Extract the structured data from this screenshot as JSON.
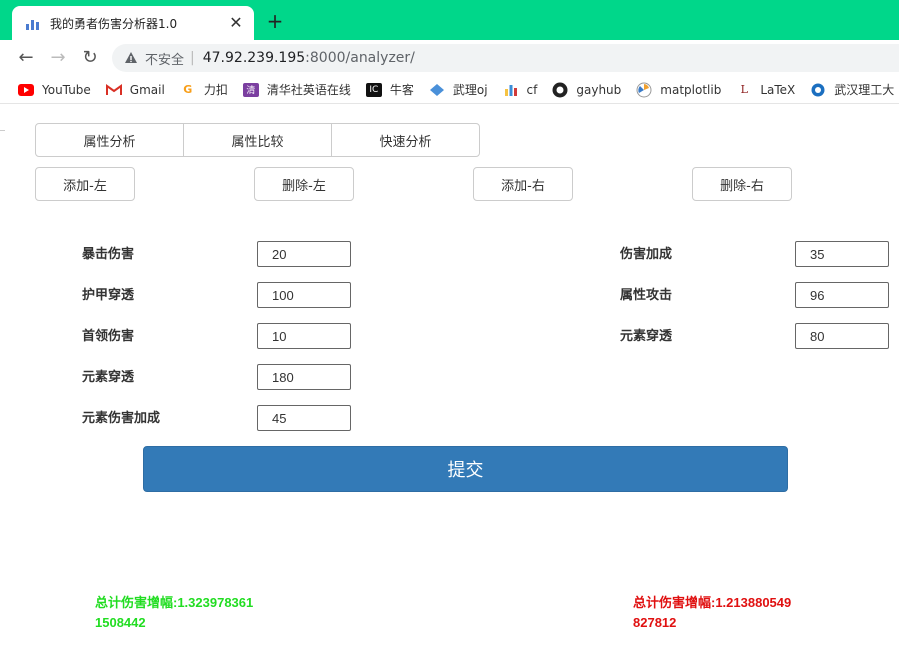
{
  "browser": {
    "tab_title": "我的勇者伤害分析器1.0",
    "insecure_label": "不安全",
    "url_host": "47.92.239.195",
    "url_path": ":8000/analyzer/",
    "bookmarks": [
      "YouTube",
      "Gmail",
      "力扣",
      "清华社英语在线",
      "牛客",
      "武理oj",
      "cf",
      "gayhub",
      "matplotlib",
      "LaTeX",
      "武汉理工大"
    ]
  },
  "tabs": [
    "属性分析",
    "属性比较",
    "快速分析"
  ],
  "actions": {
    "add_left": "添加-左",
    "delete_left": "删除-左",
    "add_right": "添加-右",
    "delete_right": "删除-右"
  },
  "left_fields": [
    {
      "label": "暴击伤害",
      "value": "20"
    },
    {
      "label": "护甲穿透",
      "value": "100"
    },
    {
      "label": "首领伤害",
      "value": "10"
    },
    {
      "label": "元素穿透",
      "value": "180"
    },
    {
      "label": "元素伤害加成",
      "value": "45"
    }
  ],
  "right_fields": [
    {
      "label": "伤害加成",
      "value": "35"
    },
    {
      "label": "属性攻击",
      "value": "96"
    },
    {
      "label": "元素穿透",
      "value": "80"
    }
  ],
  "submit_label": "提交",
  "results": {
    "left": "总计伤害增幅:1.3239783611508442",
    "right": "总计伤害增幅:1.213880549827812",
    "left_color": "#22dd22",
    "right_color": "#e01010"
  },
  "colors": {
    "tabstrip": "#00d78a",
    "submit_bg": "#337ab7"
  }
}
